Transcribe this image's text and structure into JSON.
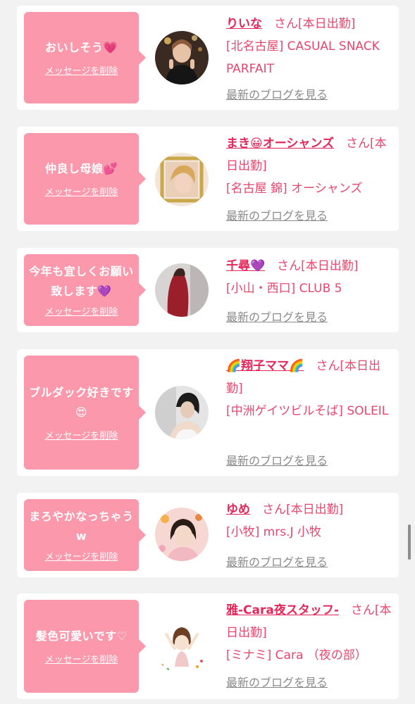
{
  "items": [
    {
      "message": "おいしそう💗",
      "delete_label": "メッセージを削除",
      "name": "りいな",
      "san_status": "　さん[本日出勤]",
      "shop": "[北名古屋] CASUAL SNACK PARFAIT",
      "blog_label": "最新のブログを見る"
    },
    {
      "message": "仲良し母娘💕",
      "delete_label": "メッセージを削除",
      "name": "まき😀オーシャンズ",
      "san_status": "　さん[本日出勤]",
      "shop": "[名古屋 錦] オーシャンズ",
      "blog_label": "最新のブログを見る"
    },
    {
      "message": "今年も宜しくお願い致します💜",
      "delete_label": "メッセージを削除",
      "name": "千尋💜",
      "san_status": "　さん[本日出勤]",
      "shop": "[小山・西口] CLUB 5",
      "blog_label": "最新のブログを見る"
    },
    {
      "message": "ブルダック好きです😍",
      "delete_label": "メッセージを削除",
      "name": "🌈翔子ママ🌈",
      "san_status": "　さん[本日出勤]",
      "shop": "[中洲ゲイツビルそば] SOLEIL",
      "blog_label": "最新のブログを見る"
    },
    {
      "message": "まろやかなっちゃうw",
      "delete_label": "メッセージを削除",
      "name": "ゆめ",
      "san_status": "　さん[本日出勤]",
      "shop": "[小牧] mrs.J 小牧",
      "blog_label": "最新のブログを見る"
    },
    {
      "message": "髪色可愛いです♡",
      "delete_label": "メッセージを削除",
      "name": "雅-Cara夜スタッフ-",
      "san_status": "　さん[本日出勤]",
      "shop": "[ミナミ] Cara （夜の部）",
      "blog_label": "最新のブログを見る"
    }
  ]
}
